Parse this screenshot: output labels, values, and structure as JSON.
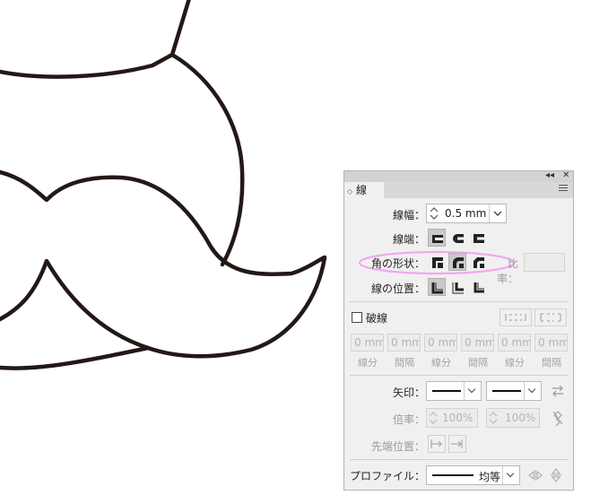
{
  "panel": {
    "tab_label": "線",
    "tab_arrow": "◇",
    "collapse_glyph": "◂◂",
    "close_glyph": "✕"
  },
  "stroke": {
    "weight_label": "線幅：",
    "weight_value": "0.5 mm",
    "cap_label": "線端：",
    "corner_label": "角の形状：",
    "miter_label": "比率：",
    "align_label": "線の位置：",
    "dashed_label": "破線"
  },
  "dash": {
    "values": [
      "0 mm",
      "0 mm",
      "0 mm",
      "0 mm",
      "0 mm",
      "0 mm"
    ],
    "labels": [
      "線分",
      "間隔",
      "線分",
      "間隔",
      "線分",
      "間隔"
    ]
  },
  "arrows": {
    "label": "矢印：",
    "scale_label": "倍率：",
    "scale_start": "100%",
    "scale_end": "100%",
    "align_label": "先端位置："
  },
  "profile": {
    "label": "プロファイル：",
    "value": "均等"
  },
  "colors": {
    "stroke": "#231815",
    "highlight": "#f0a8f0",
    "panel_bg": "#f0f0f0"
  }
}
